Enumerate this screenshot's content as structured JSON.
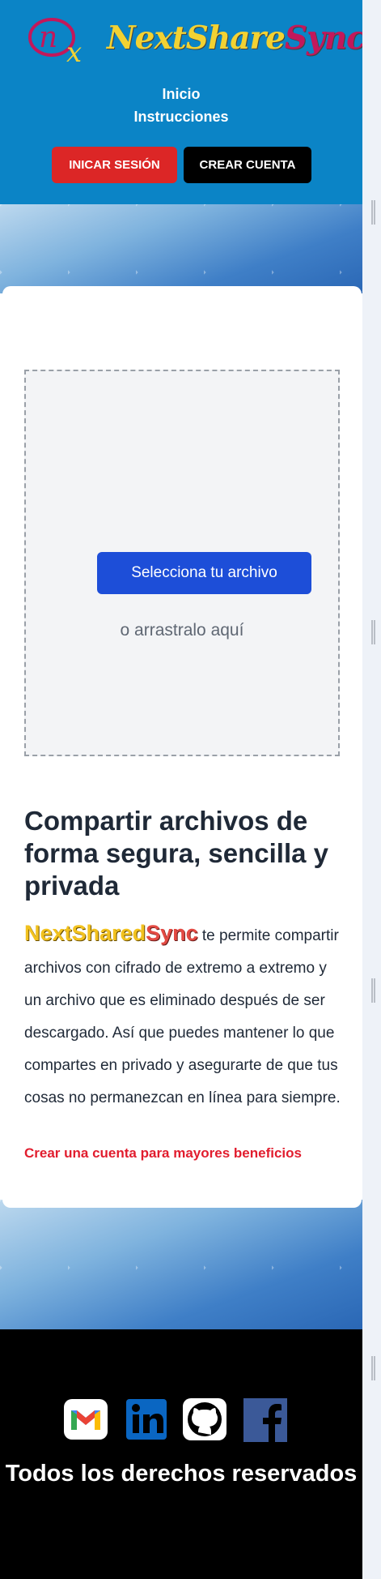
{
  "header": {
    "logo": {
      "mark_text": "nx",
      "word_next": "Next",
      "word_share": "Share",
      "word_sync": "Sync"
    },
    "nav": [
      {
        "label": "Inicio"
      },
      {
        "label": "Instrucciones"
      }
    ],
    "login_label": "INICAR SESIÓN",
    "signup_label": "CREAR CUENTA"
  },
  "upload": {
    "select_label": "Selecciona tu archivo",
    "drag_text": "o arrastralo aquí"
  },
  "info": {
    "heading": "Compartir archivos de forma segura, sencilla y privada",
    "brand_part1": "NextShared",
    "brand_part2": "Sync",
    "description": " te permite compartir archivos con cifrado de extremo a extremo y un archivo que es eliminado después de ser descargado. Así que puedes mantener lo que compartes en privado y asegurarte de que tus cosas no permanezcan en línea para siempre.",
    "cta_link": "Crear una cuenta para mayores beneficios"
  },
  "footer": {
    "social": [
      {
        "name": "gmail-icon"
      },
      {
        "name": "linkedin-icon"
      },
      {
        "name": "github-icon"
      },
      {
        "name": "facebook-icon"
      }
    ],
    "rights": "Todos los derechos reservados"
  },
  "colors": {
    "header_bg": "#0b84c6",
    "login_button": "#dc2626",
    "signup_button": "#000000",
    "select_button": "#1d4ed8",
    "cta_link": "#e11d2e",
    "brand_yellow": "#f2c21f",
    "brand_red": "#e34a43"
  }
}
